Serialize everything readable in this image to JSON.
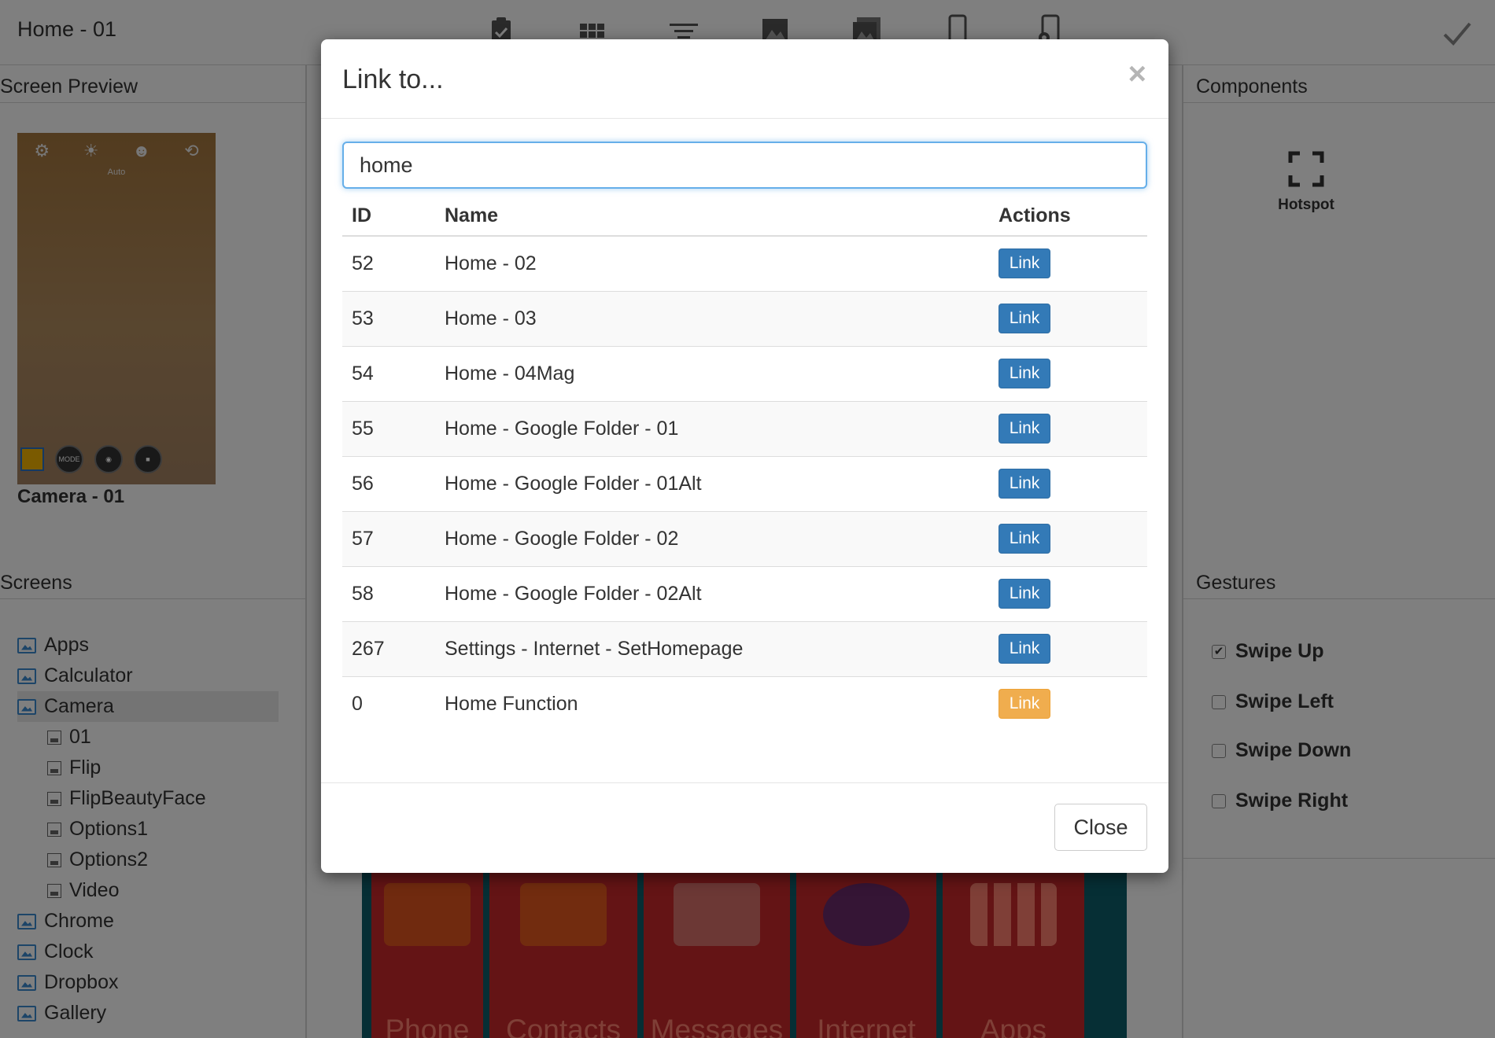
{
  "app": {
    "title": "Home - 01",
    "toolbar_icons": [
      "clipboard-check-icon",
      "grid-icon",
      "list-icon",
      "image-icon",
      "images-icon",
      "phone-icon",
      "phone-settings-icon"
    ],
    "confirm_icon": "check-icon"
  },
  "left_panel": {
    "preview_heading": "Screen Preview",
    "preview_caption": "Camera - 01",
    "preview_auto_label": "Auto",
    "preview_mode_label": "MODE",
    "screens_heading": "Screens",
    "tree": [
      {
        "label": "Apps",
        "type": "folder"
      },
      {
        "label": "Calculator",
        "type": "folder"
      },
      {
        "label": "Camera",
        "type": "folder",
        "active": true
      },
      {
        "label": "01",
        "type": "screen"
      },
      {
        "label": "Flip",
        "type": "screen"
      },
      {
        "label": "FlipBeautyFace",
        "type": "screen"
      },
      {
        "label": "Options1",
        "type": "screen"
      },
      {
        "label": "Options2",
        "type": "screen"
      },
      {
        "label": "Video",
        "type": "screen"
      },
      {
        "label": "Chrome",
        "type": "folder"
      },
      {
        "label": "Clock",
        "type": "folder"
      },
      {
        "label": "Dropbox",
        "type": "folder"
      },
      {
        "label": "Gallery",
        "type": "folder"
      }
    ]
  },
  "center_preview": {
    "tiles": [
      "Phone",
      "Contacts",
      "Messages",
      "Internet",
      "Apps"
    ]
  },
  "right_panel": {
    "components_heading": "Components",
    "hotspot_label": "Hotspot",
    "gestures_heading": "Gestures",
    "gestures": [
      {
        "label": "Swipe Up",
        "checked": true
      },
      {
        "label": "Swipe Left",
        "checked": false
      },
      {
        "label": "Swipe Down",
        "checked": false
      },
      {
        "label": "Swipe Right",
        "checked": false
      }
    ]
  },
  "modal": {
    "title": "Link to...",
    "close_symbol": "×",
    "search_value": "home",
    "columns": {
      "id": "ID",
      "name": "Name",
      "actions": "Actions"
    },
    "rows": [
      {
        "id": "52",
        "name": "Home - 02",
        "action": "Link",
        "style": "primary"
      },
      {
        "id": "53",
        "name": "Home - 03",
        "action": "Link",
        "style": "primary"
      },
      {
        "id": "54",
        "name": "Home - 04Mag",
        "action": "Link",
        "style": "primary"
      },
      {
        "id": "55",
        "name": "Home - Google Folder - 01",
        "action": "Link",
        "style": "primary"
      },
      {
        "id": "56",
        "name": "Home - Google Folder - 01Alt",
        "action": "Link",
        "style": "primary"
      },
      {
        "id": "57",
        "name": "Home - Google Folder - 02",
        "action": "Link",
        "style": "primary"
      },
      {
        "id": "58",
        "name": "Home - Google Folder - 02Alt",
        "action": "Link",
        "style": "primary"
      },
      {
        "id": "267",
        "name": "Settings - Internet - SetHomepage",
        "action": "Link",
        "style": "primary"
      },
      {
        "id": "0",
        "name": "Home Function",
        "action": "Link",
        "style": "warning"
      }
    ],
    "close_label": "Close"
  },
  "colors": {
    "primary": "#337ab7",
    "warning": "#f0ad4e",
    "focus_border": "#66afe9",
    "tile_red": "#c8292a"
  }
}
